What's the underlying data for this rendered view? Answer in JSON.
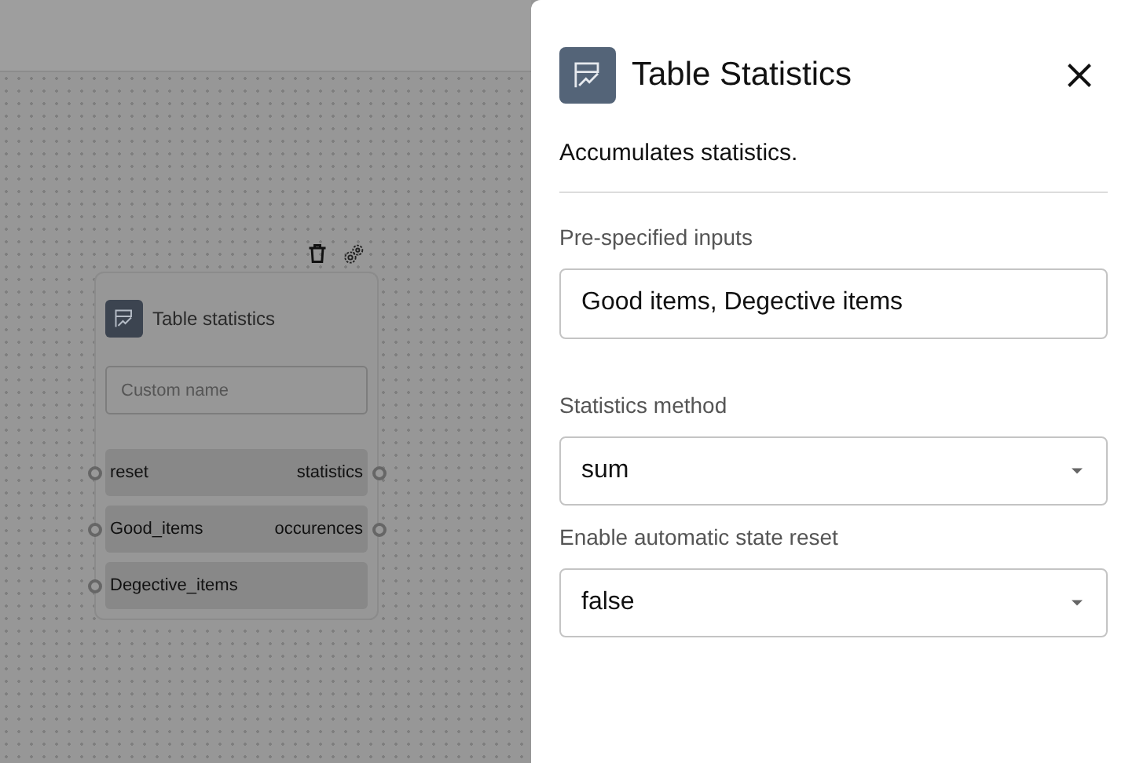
{
  "node": {
    "title": "Table statistics",
    "name_field": {
      "placeholder": "Custom name"
    },
    "rows": [
      {
        "input": "reset",
        "output": "statistics"
      },
      {
        "input": "Good_items",
        "output": "occurences"
      },
      {
        "input": "Degective_items"
      }
    ]
  },
  "panel": {
    "title": "Table Statistics",
    "description": "Accumulates statistics.",
    "fields": [
      {
        "kind": "text",
        "label": "Pre-specified inputs",
        "value": "Good items, Degective items"
      },
      {
        "kind": "select",
        "label": "Statistics method",
        "value": "sum"
      },
      {
        "kind": "select",
        "label": "Enable automatic state reset",
        "value": "false"
      }
    ]
  }
}
